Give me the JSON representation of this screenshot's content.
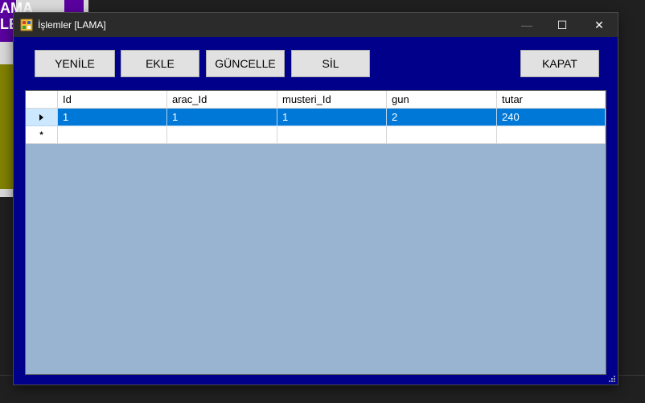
{
  "background_app": {
    "text": "AMA\nLE"
  },
  "window": {
    "title": "İşlemler [LAMA]",
    "controls": {
      "minimize": "—",
      "maximize": "☐",
      "close": "✕"
    }
  },
  "toolbar": {
    "refresh_label": "YENİLE",
    "add_label": "EKLE",
    "update_label": "GÜNCELLE",
    "delete_label": "SİL",
    "close_label": "KAPAT"
  },
  "grid": {
    "columns": [
      "Id",
      "arac_Id",
      "musteri_Id",
      "gun",
      "tutar"
    ],
    "rows": [
      {
        "cells": [
          "1",
          "1",
          "1",
          "2",
          "240"
        ],
        "selected": true,
        "indicator": "current-row-arrow"
      }
    ],
    "new_row_indicator": "*"
  },
  "colors": {
    "window_bg": "#00008b",
    "grid_bg": "#99b4d1",
    "selection": "#0078d7",
    "titlebar": "#2b2b2b"
  }
}
